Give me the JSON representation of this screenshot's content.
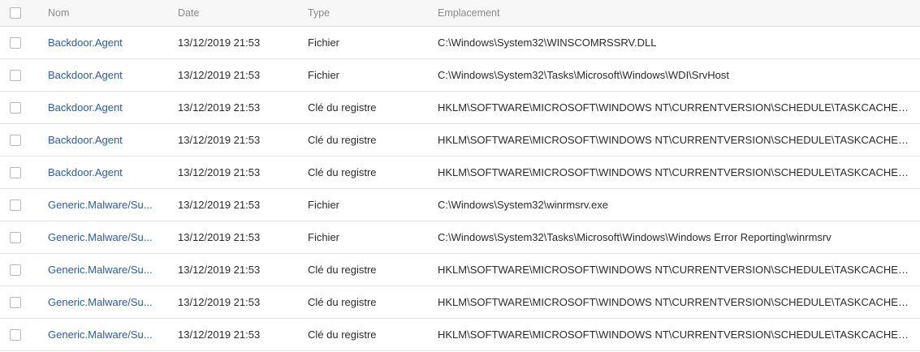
{
  "table": {
    "headers": {
      "name": "Nom",
      "date": "Date",
      "type": "Type",
      "location": "Emplacement"
    },
    "rows": [
      {
        "name": "Backdoor.Agent",
        "date": "13/12/2019 21:53",
        "type": "Fichier",
        "location": "C:\\Windows\\System32\\WINSCOMRSSRV.DLL"
      },
      {
        "name": "Backdoor.Agent",
        "date": "13/12/2019 21:53",
        "type": "Fichier",
        "location": "C:\\Windows\\System32\\Tasks\\Microsoft\\Windows\\WDI\\SrvHost"
      },
      {
        "name": "Backdoor.Agent",
        "date": "13/12/2019 21:53",
        "type": "Clé du registre",
        "location": "HKLM\\SOFTWARE\\MICROSOFT\\WINDOWS NT\\CURRENTVERSION\\SCHEDULE\\TASKCACHE\\..."
      },
      {
        "name": "Backdoor.Agent",
        "date": "13/12/2019 21:53",
        "type": "Clé du registre",
        "location": "HKLM\\SOFTWARE\\MICROSOFT\\WINDOWS NT\\CURRENTVERSION\\SCHEDULE\\TASKCACHE\\..."
      },
      {
        "name": "Backdoor.Agent",
        "date": "13/12/2019 21:53",
        "type": "Clé du registre",
        "location": "HKLM\\SOFTWARE\\MICROSOFT\\WINDOWS NT\\CURRENTVERSION\\SCHEDULE\\TASKCACHE\\..."
      },
      {
        "name": "Generic.Malware/Su...",
        "date": "13/12/2019 21:53",
        "type": "Fichier",
        "location": "C:\\Windows\\System32\\winrmsrv.exe"
      },
      {
        "name": "Generic.Malware/Su...",
        "date": "13/12/2019 21:53",
        "type": "Fichier",
        "location": "C:\\Windows\\System32\\Tasks\\Microsoft\\Windows\\Windows Error Reporting\\winrmsrv"
      },
      {
        "name": "Generic.Malware/Su...",
        "date": "13/12/2019 21:53",
        "type": "Clé du registre",
        "location": "HKLM\\SOFTWARE\\MICROSOFT\\WINDOWS NT\\CURRENTVERSION\\SCHEDULE\\TASKCACHE\\..."
      },
      {
        "name": "Generic.Malware/Su...",
        "date": "13/12/2019 21:53",
        "type": "Clé du registre",
        "location": "HKLM\\SOFTWARE\\MICROSOFT\\WINDOWS NT\\CURRENTVERSION\\SCHEDULE\\TASKCACHE\\..."
      },
      {
        "name": "Generic.Malware/Su...",
        "date": "13/12/2019 21:53",
        "type": "Clé du registre",
        "location": "HKLM\\SOFTWARE\\MICROSOFT\\WINDOWS NT\\CURRENTVERSION\\SCHEDULE\\TASKCACHE\\..."
      }
    ]
  }
}
